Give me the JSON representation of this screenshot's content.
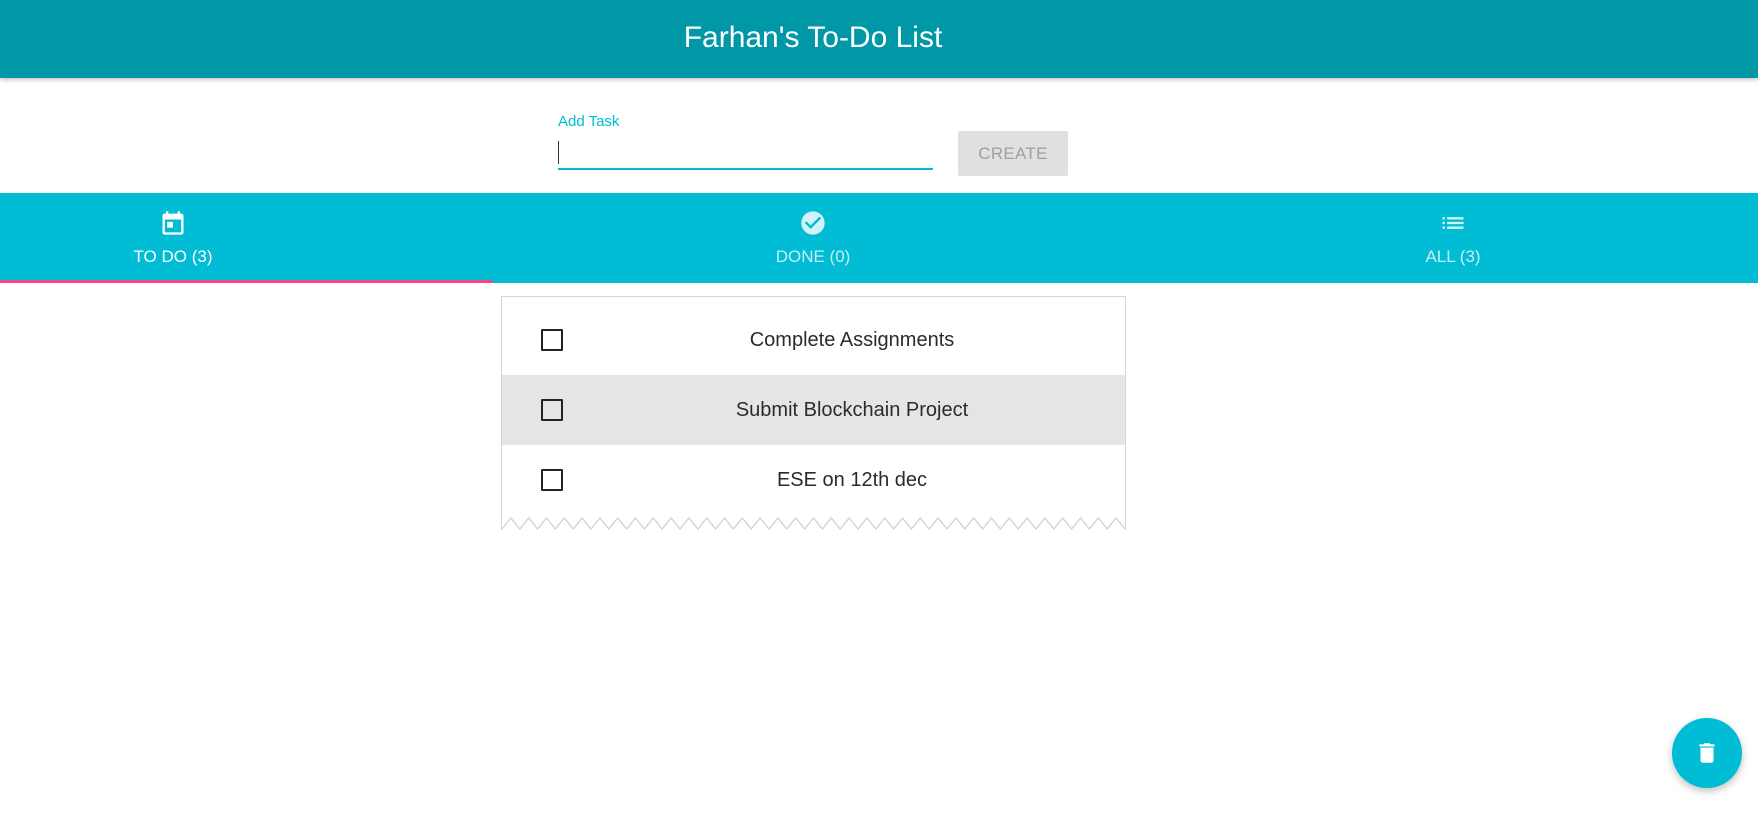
{
  "header": {
    "title": "Farhan's To-Do List"
  },
  "add_task": {
    "label": "Add Task",
    "value": "",
    "placeholder": "",
    "create_label": "CREATE"
  },
  "tabs": [
    {
      "label": "TO DO (3)",
      "icon": "calendar-icon",
      "active": true
    },
    {
      "label": "DONE (0)",
      "icon": "check-circle-icon",
      "active": false
    },
    {
      "label": "ALL (3)",
      "icon": "list-icon",
      "active": false
    }
  ],
  "tasks": [
    {
      "text": "Complete Assignments",
      "checked": false
    },
    {
      "text": "Submit Blockchain Project",
      "checked": false,
      "hovered": true
    },
    {
      "text": "ESE on 12th dec",
      "checked": false
    }
  ],
  "fab": {
    "icon": "delete-icon"
  },
  "colors": {
    "appbar": "#0097a7",
    "primary": "#00bcd4",
    "tab_indicator": "#ff4081",
    "create_button": "#e0e0e0"
  }
}
